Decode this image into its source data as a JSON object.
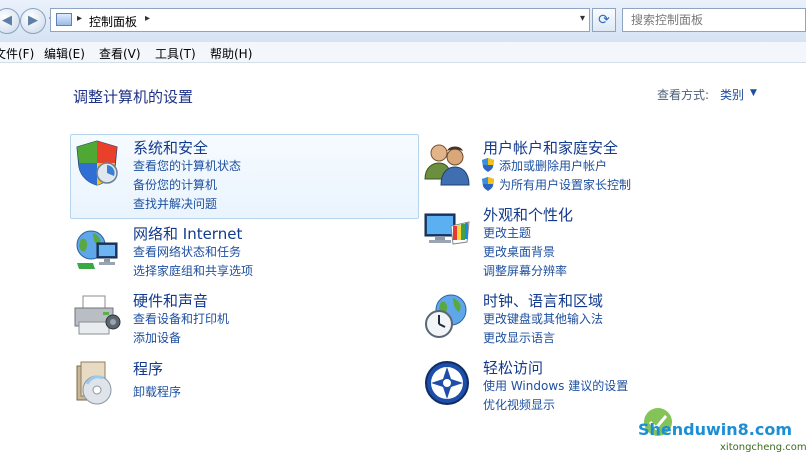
{
  "toolbar": {
    "back_glyph": "◀",
    "forward_glyph": "▶",
    "nav_dropdown_glyph": "▾",
    "address_separator": "▸",
    "address_crumb": "控制面板",
    "address_crumb_arrow": "▸",
    "address_dropdown_glyph": "▾",
    "refresh_glyph": "⟳",
    "search_placeholder": "搜索控制面板"
  },
  "menubar": {
    "items": [
      "文件(F)",
      "编辑(E)",
      "查看(V)",
      "工具(T)",
      "帮助(H)"
    ]
  },
  "main": {
    "title": "调整计算机的设置",
    "view_by_label": "查看方式:",
    "view_by_value": "类别",
    "view_by_caret": "▼"
  },
  "categories": {
    "system_security": {
      "title": "系统和安全",
      "links": [
        "查看您的计算机状态",
        "备份您的计算机",
        "查找并解决问题"
      ]
    },
    "network": {
      "title": "网络和 Internet",
      "links": [
        "查看网络状态和任务",
        "选择家庭组和共享选项"
      ]
    },
    "hardware": {
      "title": "硬件和声音",
      "links": [
        "查看设备和打印机",
        "添加设备"
      ]
    },
    "programs": {
      "title": "程序",
      "links": [
        "卸载程序"
      ]
    },
    "user_accounts": {
      "title": "用户帐户和家庭安全",
      "links": [
        "添加或删除用户帐户",
        "为所有用户设置家长控制"
      ]
    },
    "appearance": {
      "title": "外观和个性化",
      "links": [
        "更改主题",
        "更改桌面背景",
        "调整屏幕分辨率"
      ]
    },
    "clock_region": {
      "title": "时钟、语言和区域",
      "links": [
        "更改键盘或其他输入法",
        "更改显示语言"
      ]
    },
    "ease_access": {
      "title": "轻松访问",
      "links": [
        "使用 Windows 建议的设置",
        "优化视频显示"
      ]
    }
  },
  "watermark": {
    "text": "Shenduwin8.com",
    "sub": "xitongcheng.com"
  },
  "colors": {
    "link": "#1e50a0",
    "title": "#123a8c",
    "hover_border": "#b7d4ef"
  }
}
